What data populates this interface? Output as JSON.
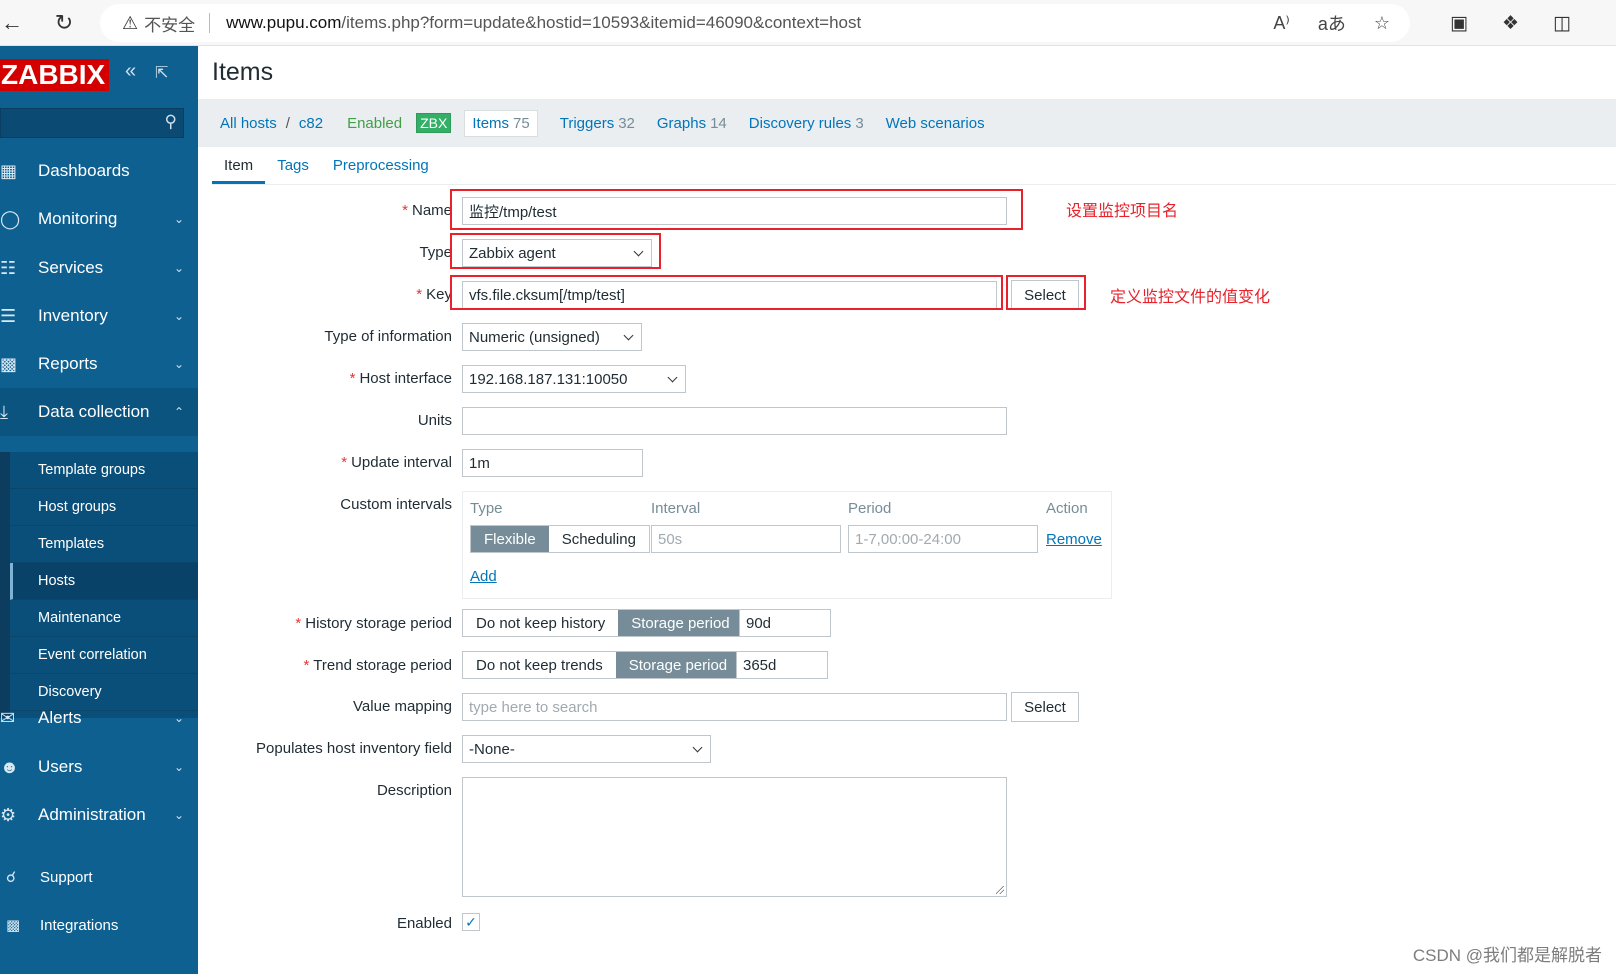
{
  "browser": {
    "security_label": "不安全",
    "url_host": "www.pupu.com",
    "url_path": "/items.php?form=update&hostid=10593&itemid=46090&context=host"
  },
  "sidebar": {
    "logo": "ZABBIX",
    "menu": [
      {
        "label": "Dashboards",
        "icon": "dashboard-icon"
      },
      {
        "label": "Monitoring",
        "icon": "eye-icon"
      },
      {
        "label": "Services",
        "icon": "sitemap-icon"
      },
      {
        "label": "Inventory",
        "icon": "list-icon"
      },
      {
        "label": "Reports",
        "icon": "report-icon"
      },
      {
        "label": "Data collection",
        "icon": "download-icon"
      },
      {
        "label": "Alerts",
        "icon": "envelope-icon"
      },
      {
        "label": "Users",
        "icon": "users-icon"
      },
      {
        "label": "Administration",
        "icon": "gear-icon"
      }
    ],
    "submenu": [
      "Template groups",
      "Host groups",
      "Templates",
      "Hosts",
      "Maintenance",
      "Event correlation",
      "Discovery"
    ],
    "support": "Support",
    "integrations": "Integrations"
  },
  "page": {
    "title": "Items"
  },
  "hostbar": {
    "all_hosts": "All hosts",
    "host": "c82",
    "enabled": "Enabled",
    "zbx": "ZBX",
    "links": [
      {
        "label": "Items",
        "count": "75"
      },
      {
        "label": "Triggers",
        "count": "32"
      },
      {
        "label": "Graphs",
        "count": "14"
      },
      {
        "label": "Discovery rules",
        "count": "3"
      },
      {
        "label": "Web scenarios",
        "count": ""
      }
    ]
  },
  "tabs": [
    "Item",
    "Tags",
    "Preprocessing"
  ],
  "form": {
    "name_label": "Name",
    "name_value": "监控/tmp/test",
    "type_label": "Type",
    "type_value": "Zabbix agent",
    "key_label": "Key",
    "key_value": "vfs.file.cksum[/tmp/test]",
    "select_label": "Select",
    "type_info_label": "Type of information",
    "type_info_value": "Numeric (unsigned)",
    "host_interface_label": "Host interface",
    "host_interface_value": "192.168.187.131:10050",
    "units_label": "Units",
    "units_value": "",
    "update_interval_label": "Update interval",
    "update_interval_value": "1m",
    "custom_intervals_label": "Custom intervals",
    "ci_headers": [
      "Type",
      "Interval",
      "Period",
      "Action"
    ],
    "ci_flexible": "Flexible",
    "ci_scheduling": "Scheduling",
    "ci_interval_placeholder": "50s",
    "ci_period_placeholder": "1-7,00:00-24:00",
    "ci_remove": "Remove",
    "ci_add": "Add",
    "history_label": "History storage period",
    "history_no": "Do not keep history",
    "history_storage": "Storage period",
    "history_value": "90d",
    "trend_label": "Trend storage period",
    "trend_no": "Do not keep trends",
    "trend_storage": "Storage period",
    "trend_value": "365d",
    "value_mapping_label": "Value mapping",
    "value_mapping_placeholder": "type here to search",
    "inventory_label": "Populates host inventory field",
    "inventory_value": "-None-",
    "description_label": "Description",
    "enabled_label": "Enabled"
  },
  "annotations": {
    "name_note": "设置监控项目名",
    "key_note": "定义监控文件的值变化"
  },
  "watermark": "CSDN @我们都是解脱者",
  "colors": {
    "sidebar": "#0e6091",
    "link": "#0275b8",
    "required": "#e33734",
    "annotation": "#e8212a",
    "zbx_badge": "#34af67"
  }
}
